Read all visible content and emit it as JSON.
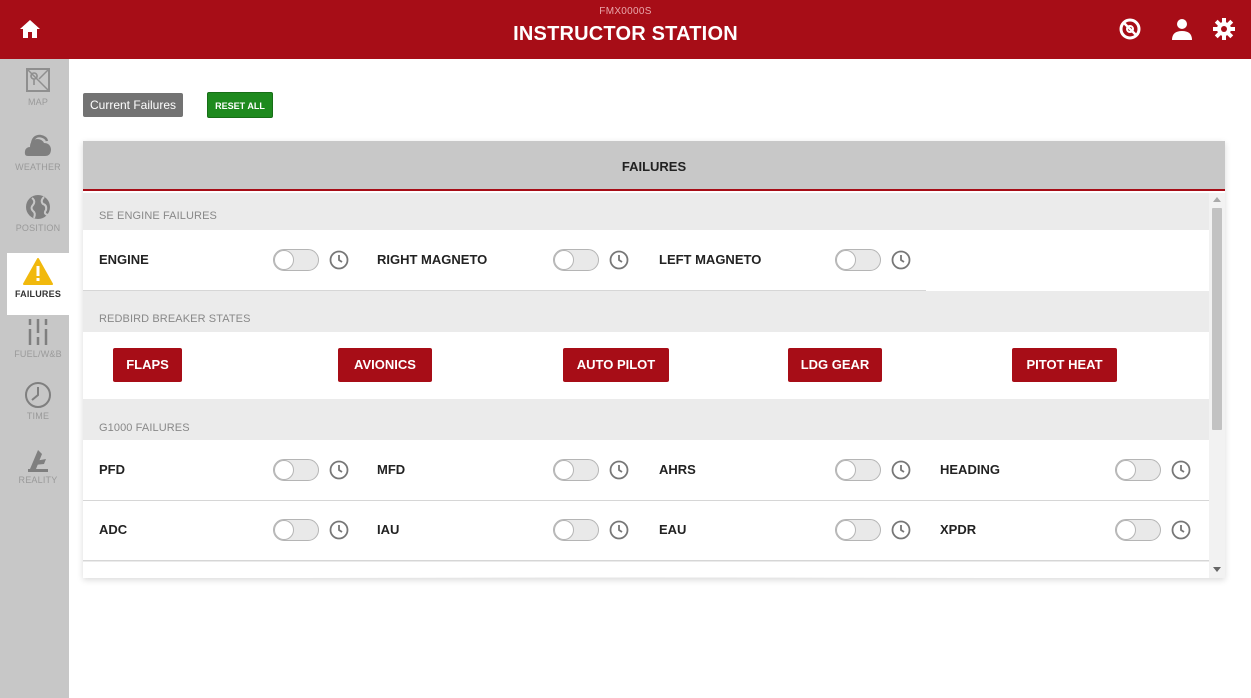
{
  "header": {
    "subtitle": "FMX0000S",
    "title": "INSTRUCTOR STATION"
  },
  "sidebar": {
    "items": [
      {
        "label": "MAP",
        "icon": "map-icon"
      },
      {
        "label": "WEATHER",
        "icon": "cloud-icon"
      },
      {
        "label": "POSITION",
        "icon": "globe-icon"
      },
      {
        "label": "FAILURES",
        "icon": "warning-icon",
        "active": true
      },
      {
        "label": "FUEL/W&B",
        "icon": "sliders-icon"
      },
      {
        "label": "TIME",
        "icon": "clock-icon"
      },
      {
        "label": "REALITY",
        "icon": "reality-icon"
      }
    ]
  },
  "toolbar": {
    "current_failures": "Current Failures",
    "reset_all": "RESET ALL"
  },
  "panel": {
    "title": "FAILURES",
    "sections": {
      "se_engine": {
        "title": "SE ENGINE FAILURES",
        "items": [
          "ENGINE",
          "RIGHT MAGNETO",
          "LEFT MAGNETO"
        ]
      },
      "breakers": {
        "title": "REDBIRD BREAKER STATES",
        "items": [
          "FLAPS",
          "AVIONICS",
          "AUTO PILOT",
          "LDG GEAR",
          "PITOT HEAT"
        ]
      },
      "g1000": {
        "title": "G1000 FAILURES",
        "rows": [
          [
            "PFD",
            "MFD",
            "AHRS",
            "HEADING"
          ],
          [
            "ADC",
            "IAU",
            "EAU",
            "XPDR"
          ]
        ]
      }
    }
  },
  "colors": {
    "brand_red": "#a70d17",
    "reset_green": "#1e8a1e",
    "sidebar_gray": "#c7c7c7"
  }
}
